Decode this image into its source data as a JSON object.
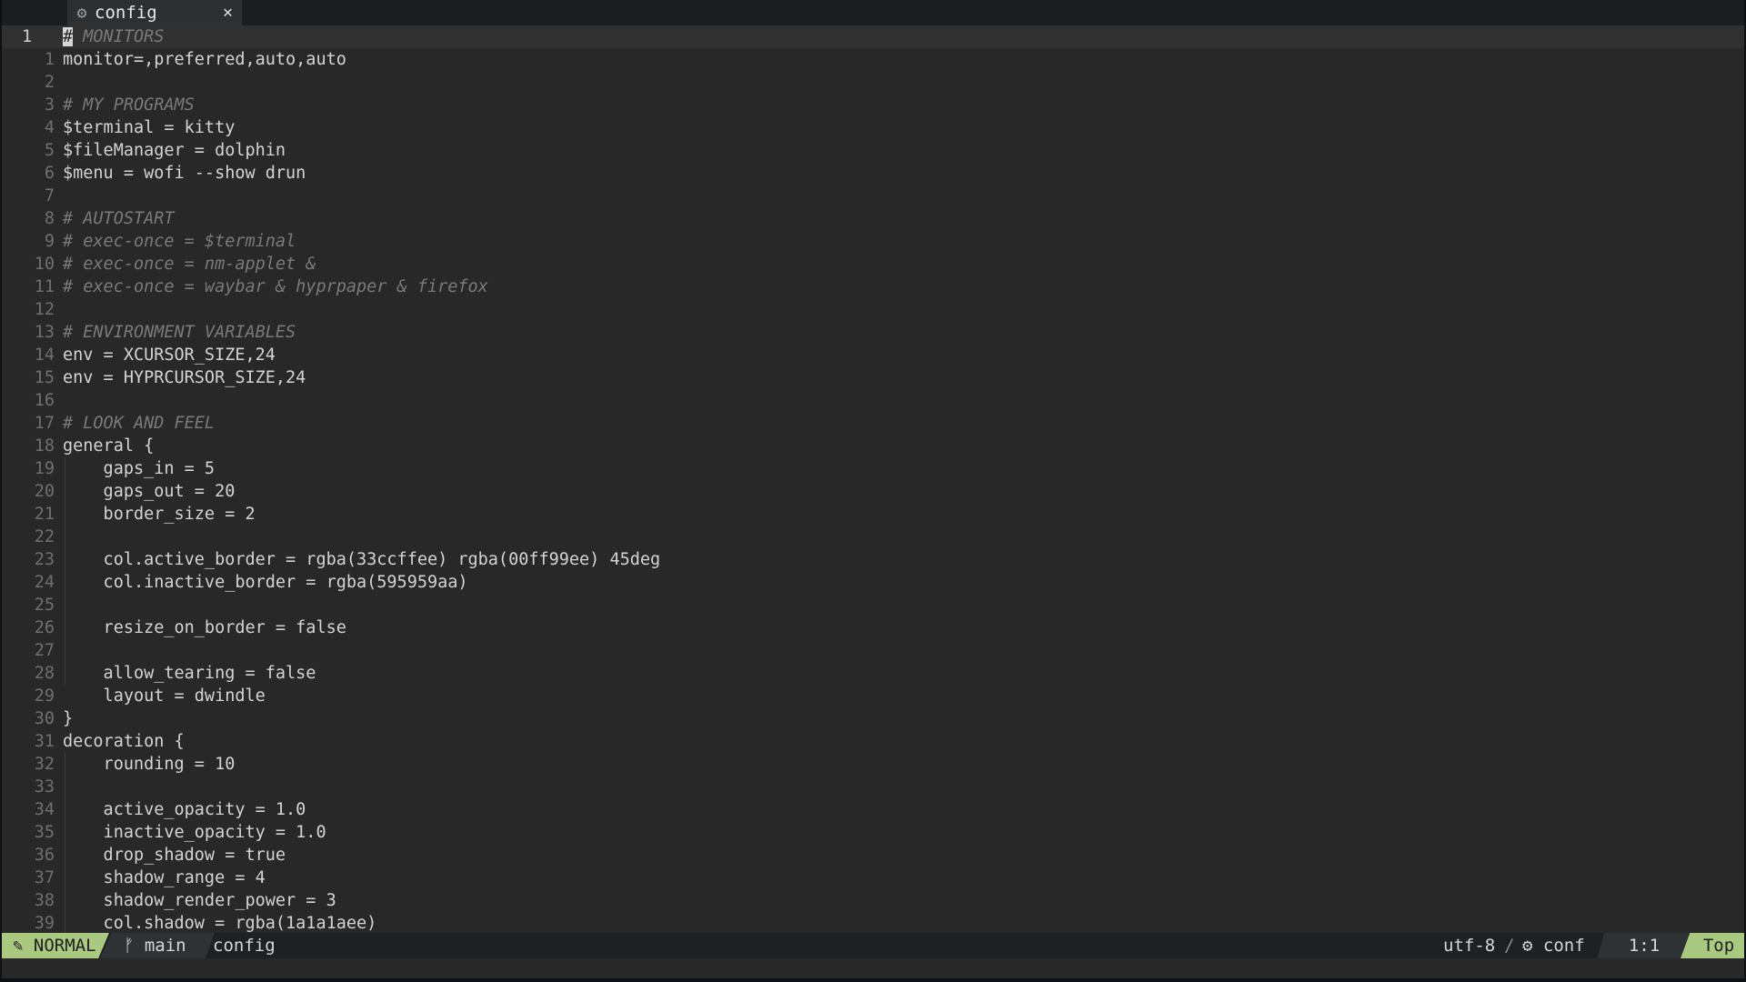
{
  "tab": {
    "icon": "gear-icon",
    "label": "config",
    "close": "✕"
  },
  "cursor_char": "#",
  "current_line_number": "1",
  "lines": [
    {
      "n": "",
      "t": " MONITORS",
      "c": true,
      "cur": true
    },
    {
      "n": "1",
      "t": "monitor=,preferred,auto,auto"
    },
    {
      "n": "2",
      "t": ""
    },
    {
      "n": "3",
      "t": "# MY PROGRAMS",
      "c": true
    },
    {
      "n": "4",
      "t": "$terminal = kitty"
    },
    {
      "n": "5",
      "t": "$fileManager = dolphin"
    },
    {
      "n": "6",
      "t": "$menu = wofi --show drun"
    },
    {
      "n": "7",
      "t": ""
    },
    {
      "n": "8",
      "t": "# AUTOSTART",
      "c": true
    },
    {
      "n": "9",
      "t": "# exec-once = $terminal",
      "c": true
    },
    {
      "n": "10",
      "t": "# exec-once = nm-applet &",
      "c": true
    },
    {
      "n": "11",
      "t": "# exec-once = waybar & hyprpaper & firefox",
      "c": true
    },
    {
      "n": "12",
      "t": ""
    },
    {
      "n": "13",
      "t": "# ENVIRONMENT VARIABLES",
      "c": true
    },
    {
      "n": "14",
      "t": "env = XCURSOR_SIZE,24"
    },
    {
      "n": "15",
      "t": "env = HYPRCURSOR_SIZE,24"
    },
    {
      "n": "16",
      "t": ""
    },
    {
      "n": "17",
      "t": "# LOOK AND FEEL",
      "c": true
    },
    {
      "n": "18",
      "t": "general {"
    },
    {
      "n": "19",
      "t": "    gaps_in = 5"
    },
    {
      "n": "20",
      "t": "    gaps_out = 20"
    },
    {
      "n": "21",
      "t": "    border_size = 2"
    },
    {
      "n": "22",
      "t": ""
    },
    {
      "n": "23",
      "t": "    col.active_border = rgba(33ccffee) rgba(00ff99ee) 45deg"
    },
    {
      "n": "24",
      "t": "    col.inactive_border = rgba(595959aa)"
    },
    {
      "n": "25",
      "t": ""
    },
    {
      "n": "26",
      "t": "    resize_on_border = false"
    },
    {
      "n": "27",
      "t": ""
    },
    {
      "n": "28",
      "t": "    allow_tearing = false"
    },
    {
      "n": "29",
      "t": "    layout = dwindle"
    },
    {
      "n": "30",
      "t": "}"
    },
    {
      "n": "31",
      "t": "decoration {"
    },
    {
      "n": "32",
      "t": "    rounding = 10"
    },
    {
      "n": "33",
      "t": ""
    },
    {
      "n": "34",
      "t": "    active_opacity = 1.0"
    },
    {
      "n": "35",
      "t": "    inactive_opacity = 1.0"
    },
    {
      "n": "36",
      "t": "    drop_shadow = true"
    },
    {
      "n": "37",
      "t": "    shadow_range = 4"
    },
    {
      "n": "38",
      "t": "    shadow_render_power = 3"
    },
    {
      "n": "39",
      "t": "    col.shadow = rgba(1a1a1aee)"
    }
  ],
  "status": {
    "mode_icon": "vim-icon",
    "mode": "NORMAL",
    "branch_icon": "git-branch-icon",
    "branch": "main",
    "file": "config",
    "encoding": "utf-8",
    "separator": "/",
    "filetype_icon": "gear-icon",
    "filetype": "conf",
    "position": "1:1",
    "scroll": "Top"
  },
  "colors": {
    "background": "#282828",
    "comment": "#7a7a7a",
    "mode_accent": "#a9c980"
  }
}
